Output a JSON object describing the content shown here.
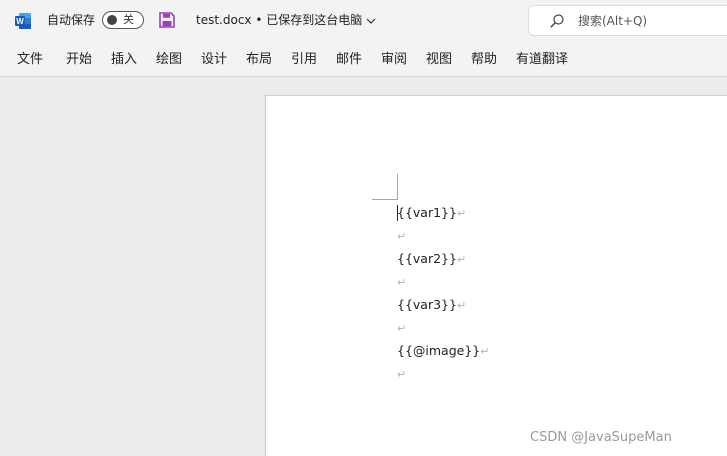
{
  "titlebar": {
    "autosave_label": "自动保存",
    "autosave_state": "关",
    "document_title": "test.docx • 已保存到这台电脑"
  },
  "search": {
    "placeholder": "搜索(Alt+Q)"
  },
  "menu": [
    "文件",
    "开始",
    "插入",
    "绘图",
    "设计",
    "布局",
    "引用",
    "邮件",
    "审阅",
    "视图",
    "帮助",
    "有道翻译"
  ],
  "document": {
    "paragraphs": [
      "{{var1}}",
      "",
      "{{var2}}",
      "",
      "{{var3}}",
      "",
      "{{@image}}",
      ""
    ],
    "paragraph_mark": "↵"
  },
  "watermark": "CSDN @JavaSupeMan",
  "colors": {
    "word_blue": "#185abd",
    "save_purple": "#9b3fbf",
    "toolbar_bg": "#f3f3f3",
    "canvas_bg": "#ececec"
  }
}
